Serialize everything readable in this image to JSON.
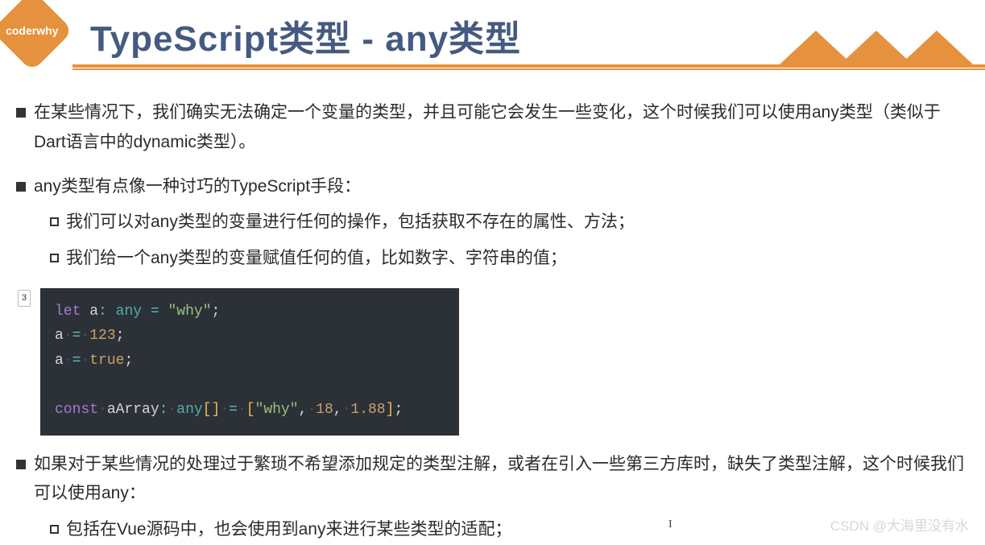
{
  "logo_text": "coderwhy",
  "title": "TypeScript类型 - any类型",
  "bullets": {
    "b1": "在某些情况下，我们确实无法确定一个变量的类型，并且可能它会发生一些变化，这个时候我们可以使用any类型（类似于Dart语言中的dynamic类型）。",
    "b2": "any类型有点像一种讨巧的TypeScript手段：",
    "b2_s": [
      "我们可以对any类型的变量进行任何的操作，包括获取不存在的属性、方法；",
      "我们给一个any类型的变量赋值任何的值，比如数字、字符串的值；"
    ],
    "b3": "如果对于某些情况的处理过于繁琐不希望添加规定的类型注解，或者在引入一些第三方库时，缺失了类型注解，这个时候我们可以使用any：",
    "b3_s": [
      "包括在Vue源码中，也会使用到any来进行某些类型的适配；"
    ]
  },
  "code_badge": "3",
  "code": {
    "l1": {
      "kw": "let",
      "var": "a",
      "type": "any",
      "str": "\"why\""
    },
    "l2": {
      "var": "a",
      "num": "123"
    },
    "l3": {
      "var": "a",
      "bool": "true"
    },
    "l5": {
      "kw": "const",
      "var": "aArray",
      "type": "any",
      "arr_open": "[",
      "arr_close": "]",
      "s1": "\"why\"",
      "n1": "18",
      "n2": "1.88"
    }
  },
  "watermark": "CSDN @大海里没有水"
}
